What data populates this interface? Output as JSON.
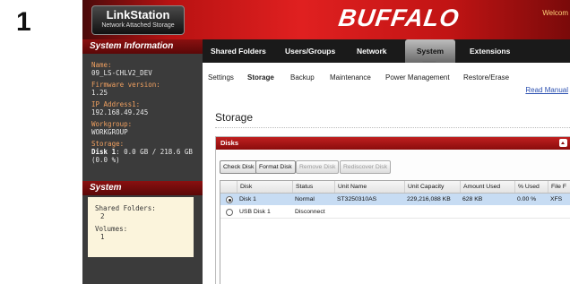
{
  "step_number": "1",
  "header": {
    "logo_title": "LinkStation",
    "logo_subtitle": "Network Attached Storage",
    "brand": "BUFFALO",
    "welcome": "Welcom"
  },
  "sidebar": {
    "info_title": "System Information",
    "name_label": "Name:",
    "name_value": "09_LS-CHLV2_DEV",
    "fw_label": "Firmware version:",
    "fw_value": "1.25",
    "ip_label": "IP Address1:",
    "ip_value": "192.168.49.245",
    "wg_label": "Workgroup:",
    "wg_value": "WORKGROUP",
    "storage_label": "Storage:",
    "storage_disk": "Disk 1",
    "storage_value": ": 0.0 GB / 218.6 GB",
    "storage_pct": "(0.0 %)",
    "system_title": "System",
    "shared_label": "Shared Folders:",
    "shared_value": "2",
    "volumes_label": "Volumes:",
    "volumes_value": "1"
  },
  "mainnav": {
    "tabs": [
      "Shared Folders",
      "Users/Groups",
      "Network",
      "System",
      "Extensions"
    ],
    "active": "System"
  },
  "subnav": {
    "tabs": [
      "Settings",
      "Storage",
      "Backup",
      "Maintenance",
      "Power Management",
      "Restore/Erase"
    ],
    "active": "Storage",
    "help": "Read Manual"
  },
  "page": {
    "title": "Storage",
    "panel_title": "Disks",
    "buttons": [
      "Check Disk",
      "Format Disk",
      "Remove Disk",
      "Rediscover Disk"
    ],
    "table": {
      "headers": [
        "Disk",
        "Status",
        "Unit Name",
        "Unit Capacity",
        "Amount Used",
        "% Used",
        "File F"
      ],
      "rows": [
        [
          "Disk 1",
          "Normal",
          "ST3250310AS",
          "229,216,088 KB",
          "628 KB",
          "0.00 %",
          "XFS"
        ],
        [
          "USB Disk 1",
          "Disconnect",
          "",
          "",
          "",
          "",
          ""
        ]
      ]
    }
  },
  "colors": {
    "header_red": "#e02020",
    "sidebar_dark": "#3b3b3b",
    "accent_orange": "#f0a060",
    "selected_row": "#c7dcf3"
  }
}
